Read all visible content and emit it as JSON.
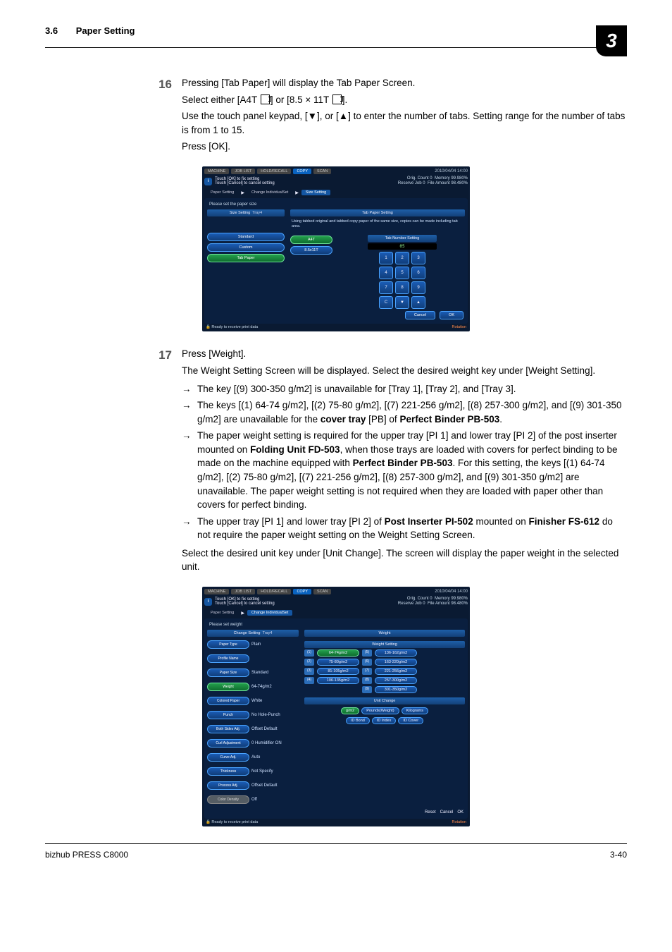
{
  "chapter_number": "3",
  "header": {
    "section_number": "3.6",
    "section_title": "Paper Setting"
  },
  "tri_down": "▼",
  "tri_up": "▲",
  "step16": {
    "num": "16",
    "line1a": "Pressing [Tab Paper] will display the Tab Paper Screen.",
    "line2_pre": "Select either [A4T ",
    "line2_mid": "] or [8.5 × 11T ",
    "line2_post": "].",
    "line3_pre": "Use the touch panel keypad, [",
    "line3_mid": "], or [",
    "line3_post": "] to enter the number of tabs. Setting range for the number of tabs is from 1 to 15.",
    "line4": "Press [OK]."
  },
  "step17": {
    "num": "17",
    "line1": "Press [Weight].",
    "line2": "The Weight Setting Screen will be displayed. Select the desired weight key under [Weight Setting].",
    "b1": "The key [(9) 300-350 g/m2] is unavailable for [Tray 1], [Tray 2], and [Tray 3].",
    "b2_a": "The keys [(1) 64-74 g/m2], [(2) 75-80 g/m2], [(7) 221-256 g/m2], [(8) 257-300 g/m2], and [(9) 301-350 g/m2] are unavailable for the ",
    "b2_bold1": "cover tray",
    "b2_b": " [PB] of ",
    "b2_bold2": "Perfect Binder PB-503",
    "b2_c": ".",
    "b3_a": "The paper weight setting is required for the upper tray [PI 1] and lower tray [PI 2] of the post inserter mounted on ",
    "b3_bold1": "Folding Unit FD-503",
    "b3_b": ", when those trays are loaded with covers for perfect binding to be made on the machine equipped with ",
    "b3_bold2": "Perfect Binder PB-503",
    "b3_c": ". For this setting, the keys [(1) 64-74 g/m2], [(2) 75-80 g/m2], [(7) 221-256 g/m2], [(8) 257-300 g/m2], and [(9) 301-350 g/m2] are unavailable. The paper weight setting is not required when they are loaded with paper other than covers for perfect binding.",
    "b4_a": "The upper tray [PI 1] and lower tray [PI 2] of ",
    "b4_bold1": "Post Inserter PI-502",
    "b4_b": " mounted on ",
    "b4_bold2": "Finisher FS-612",
    "b4_c": " do not require the paper weight setting on the Weight Setting Screen.",
    "line3": "Select the desired unit key under [Unit Change]. The screen will display the paper weight in the selected unit."
  },
  "scr": {
    "tabs": {
      "machine": "MACHINE",
      "joblist": "JOB LIST",
      "recall": "HOLD/RECALL",
      "copy": "COPY",
      "scan": "SCAN"
    },
    "datetime": "2010/04/04 14:00",
    "info1": "Touch [OK] to fix setting",
    "info2": "Touch [Cancel] to cancel setting",
    "orig_count_l": "Orig. Count",
    "orig_count_v": "0",
    "mem_l": "Memory",
    "mem_v": "99.980%",
    "res_l": "Reserve Job",
    "res_v": "0",
    "file_l": "File Amount",
    "file_v": "98.480%",
    "status": "Ready to receive print data",
    "rotation": "Rotation",
    "cancel": "Cancel",
    "ok": "OK",
    "reset": "Reset"
  },
  "scr1": {
    "bread1": "Paper Setting",
    "bread2": "Change IndividualSet",
    "bread3": "Size Setting",
    "prompt": "Please set the paper size",
    "left_title": "Size Setting",
    "tray_lbl": "Tray4",
    "btn_standard": "Standard",
    "btn_custom": "Custom",
    "btn_tab": "Tab Paper",
    "right_title": "Tab Paper Setting",
    "note": "Using tabbed original and tabbed copy paper of the same size, copies can be made including tab area.",
    "a4t": "A4T",
    "letter": "8.5x11T",
    "tabnum_title": "Tab Number Setting",
    "tabnum_value": "05",
    "keys": [
      "1",
      "2",
      "3",
      "4",
      "5",
      "6",
      "7",
      "8",
      "9",
      "C",
      "▼",
      "▲"
    ]
  },
  "scr2": {
    "bread1": "Paper Setting",
    "bread2": "Change IndividualSet",
    "prompt": "Please set weight",
    "left_title": "Change Setting",
    "tray_lbl": "Tray4",
    "rows": [
      {
        "lbl": "Paper Type",
        "val": "Plain"
      },
      {
        "lbl": "Profile Name",
        "val": ""
      },
      {
        "lbl": "Paper Size",
        "val": "Standard"
      },
      {
        "lbl": "Weight",
        "val": "64-74g/m2"
      },
      {
        "lbl": "Colored Paper",
        "val": "White"
      },
      {
        "lbl": "Punch",
        "val": "No Hole-Punch"
      },
      {
        "lbl": "Both Sides Adj.",
        "val": "Offset Default"
      },
      {
        "lbl": "Curl Adjustment",
        "val": "0   Humidifier ON"
      },
      {
        "lbl": "Curve Adj.",
        "val": "Auto"
      },
      {
        "lbl": "Thickness",
        "val": "Not Specify"
      },
      {
        "lbl": "Process Adj.",
        "val": "Offset Default"
      },
      {
        "lbl": "Color Density",
        "val": "Off"
      }
    ],
    "right_title": "Weight",
    "ws_title": "Weight Setting",
    "weights_left": [
      {
        "n": "(1)",
        "v": "64-74g/m2"
      },
      {
        "n": "(2)",
        "v": "75-80g/m2"
      },
      {
        "n": "(3)",
        "v": "81-105g/m2"
      },
      {
        "n": "(4)",
        "v": "106-135g/m2"
      }
    ],
    "weights_right": [
      {
        "n": "(5)",
        "v": "136-162g/m2"
      },
      {
        "n": "(6)",
        "v": "163-220g/m2"
      },
      {
        "n": "(7)",
        "v": "221-256g/m2"
      },
      {
        "n": "(8)",
        "v": "257-300g/m2"
      },
      {
        "n": "(9)",
        "v": "301-350g/m2"
      }
    ],
    "uc_title": "Unit Change",
    "units1": [
      "g/m2",
      "Pounds(Weight)",
      "Kilograms"
    ],
    "units2": [
      "ID Bond",
      "ID Index",
      "ID Cover"
    ]
  },
  "footer": {
    "model": "bizhub PRESS C8000",
    "page": "3-40"
  }
}
